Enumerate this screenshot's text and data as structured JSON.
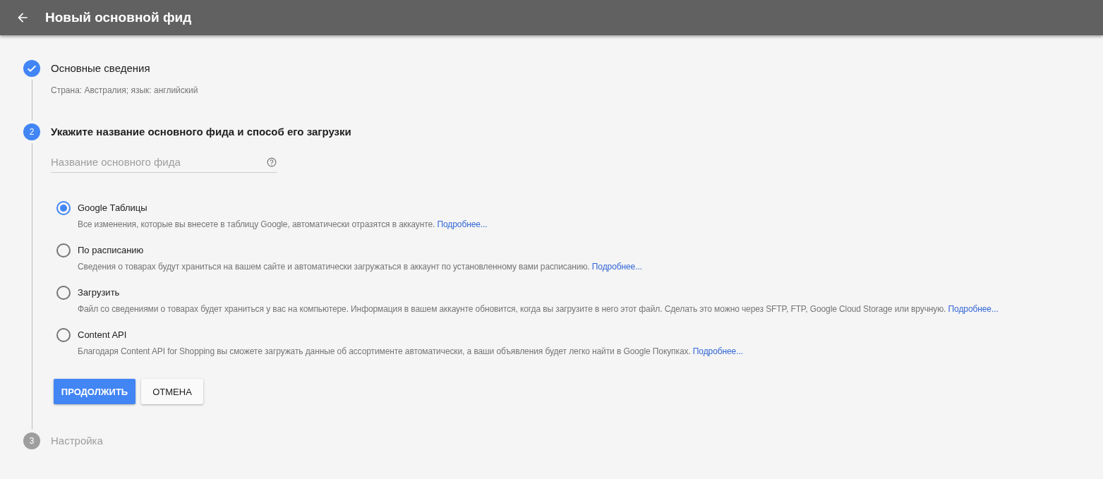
{
  "header": {
    "title": "Новый основной фид"
  },
  "steps": [
    {
      "done": true,
      "active": false,
      "title": "Основные сведения",
      "summary": "Страна: Австралия; язык: английский"
    },
    {
      "done": false,
      "active": true,
      "number": "2",
      "title": "Укажите название основного фида и способ его загрузки",
      "name_field": {
        "placeholder": "Название основного фида"
      },
      "upload_methods": [
        {
          "label": "Google Таблицы",
          "description": "Все изменения, которые вы внесете в таблицу Google, автоматически отразятся в аккаунте.",
          "link": "Подробнее...",
          "selected": true
        },
        {
          "label": "По расписанию",
          "description": "Сведения о товарах будут храниться на вашем сайте и автоматически загружаться в аккаунт по установленному вами расписанию.",
          "link": "Подробнее...",
          "selected": false
        },
        {
          "label": "Загрузить",
          "description": "Файл со сведениями о товарах будет храниться у вас на компьютере. Информация в вашем аккаунте обновится, когда вы загрузите в него этот файл. Сделать это можно через SFTP, FTP, Google Cloud Storage или вручную.",
          "link": "Подробнее...",
          "selected": false
        },
        {
          "label": "Content API",
          "description": "Благодаря Content API for Shopping вы сможете загружать данные об ассортименте автоматически, а ваши объявления будет легко найти в Google Покупках.",
          "link": "Подробнее...",
          "selected": false
        }
      ],
      "buttons": [
        {
          "label": "ПРОДОЛЖИТЬ",
          "kind": "primary"
        },
        {
          "label": "ОТМЕНА",
          "kind": "secondary"
        }
      ]
    },
    {
      "done": false,
      "active": false,
      "number": "3",
      "title": "Настройка"
    }
  ]
}
